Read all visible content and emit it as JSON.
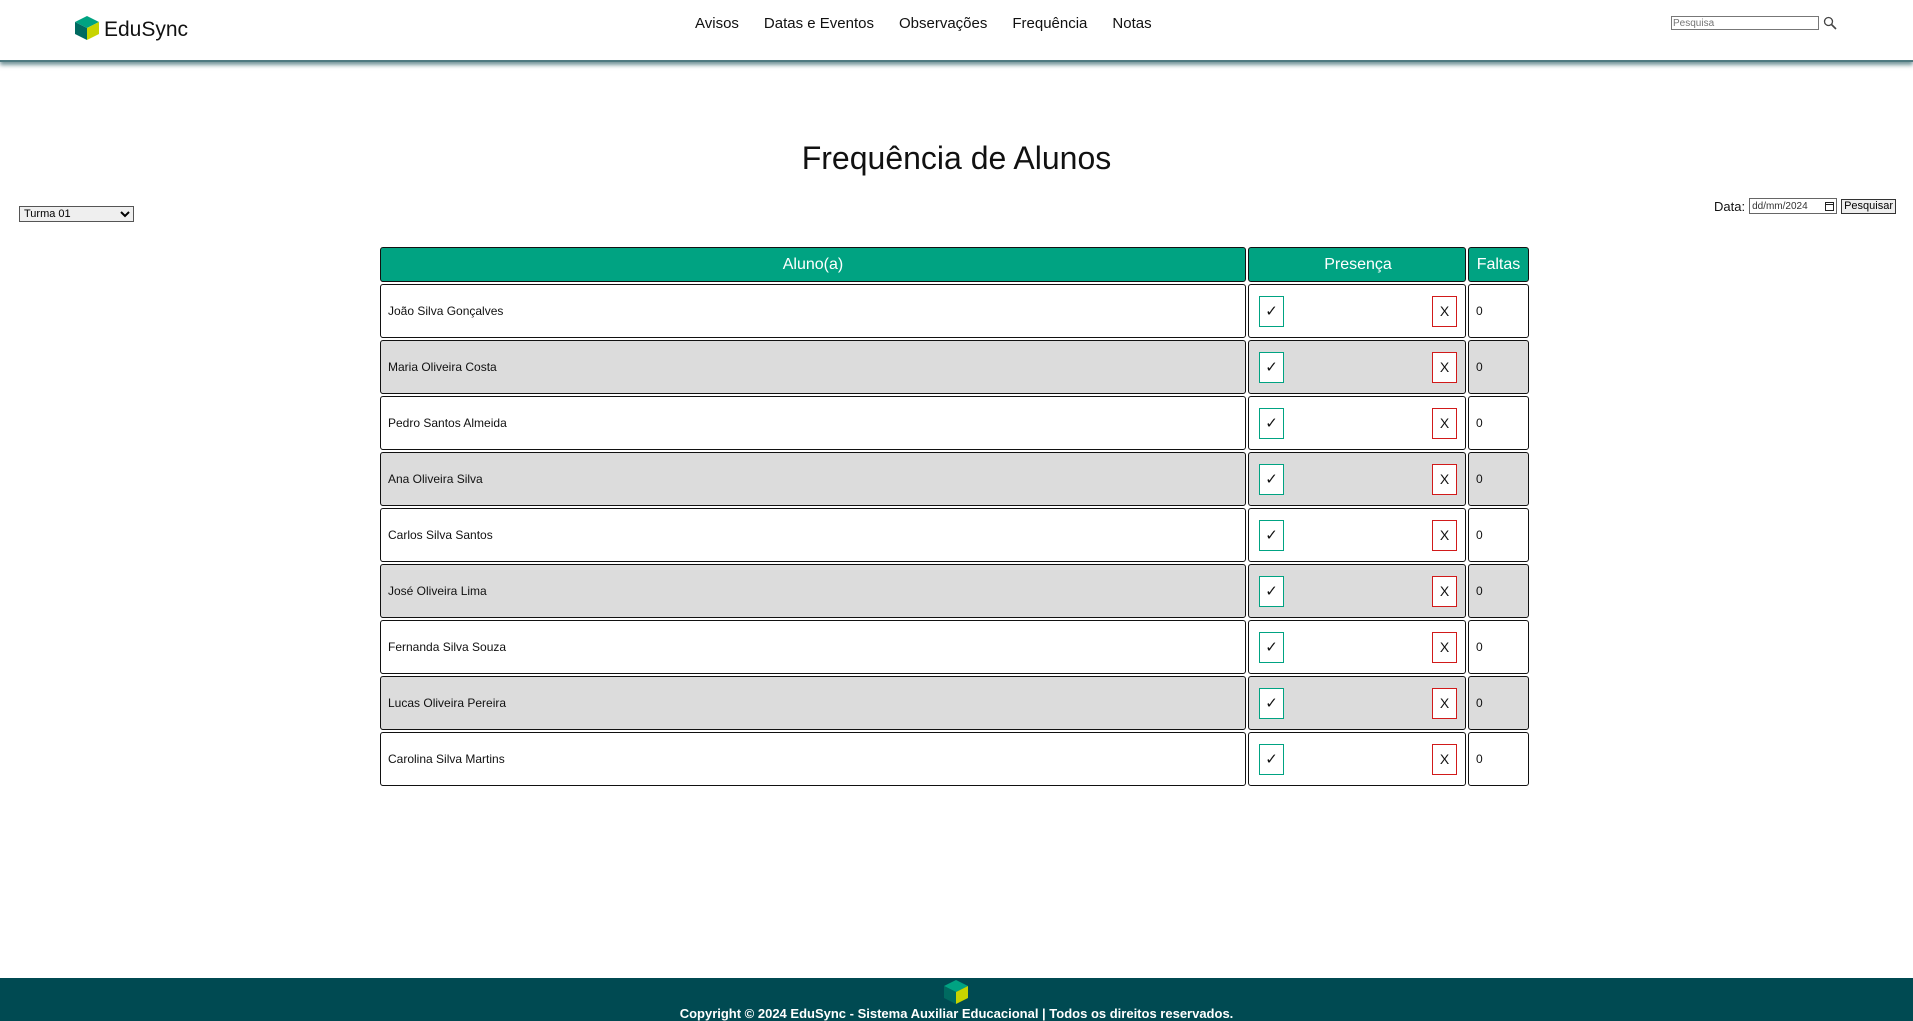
{
  "brand": {
    "name": "EduSync",
    "color_primary": "#00a382",
    "color_dark": "#004a52"
  },
  "nav": {
    "items": [
      {
        "label": "Avisos"
      },
      {
        "label": "Datas e Eventos"
      },
      {
        "label": "Observações"
      },
      {
        "label": "Frequência"
      },
      {
        "label": "Notas"
      }
    ]
  },
  "search": {
    "placeholder": "Pesquisa",
    "icon": "magnifier-icon"
  },
  "page": {
    "title": "Frequência de Alunos"
  },
  "filters": {
    "turma_selected": "Turma 01",
    "date_label": "Data:",
    "date_placeholder_day": "dd/mm/",
    "date_year": "2024",
    "search_button": "Pesquisar"
  },
  "table": {
    "headers": {
      "student": "Aluno(a)",
      "presence": "Presença",
      "absences": "Faltas"
    },
    "present_symbol": "✓",
    "absent_symbol": "X",
    "rows": [
      {
        "name": "João Silva Gonçalves",
        "faltas": "0"
      },
      {
        "name": "Maria Oliveira Costa",
        "faltas": "0"
      },
      {
        "name": "Pedro Santos Almeida",
        "faltas": "0"
      },
      {
        "name": "Ana Oliveira Silva",
        "faltas": "0"
      },
      {
        "name": "Carlos Silva Santos",
        "faltas": "0"
      },
      {
        "name": "José Oliveira Lima",
        "faltas": "0"
      },
      {
        "name": "Fernanda Silva Souza",
        "faltas": "0"
      },
      {
        "name": "Lucas Oliveira Pereira",
        "faltas": "0"
      },
      {
        "name": "Carolina Silva Martins",
        "faltas": "0"
      }
    ]
  },
  "footer": {
    "copyright": "Copyright © 2024 EduSync - Sistema Auxiliar Educacional | Todos os direitos reservados."
  }
}
